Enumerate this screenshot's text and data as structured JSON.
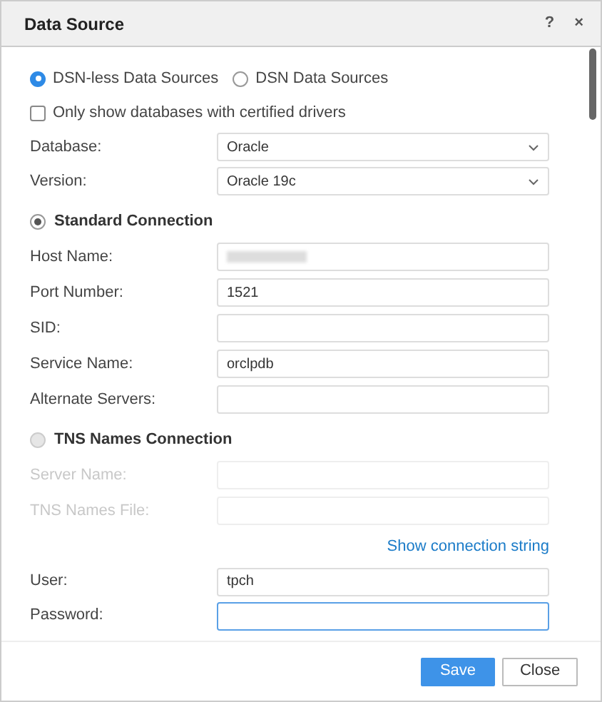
{
  "window": {
    "title": "Data Source",
    "controls": [
      "?",
      "×"
    ]
  },
  "source_types": [
    {
      "label": "DSN-less Data Sources",
      "selected": true
    },
    {
      "label": "DSN Data Sources",
      "selected": false
    }
  ],
  "certified_filter": {
    "label": "Only show databases with certified drivers",
    "checked": false
  },
  "selects": [
    {
      "label": "Database:",
      "value": "Oracle"
    },
    {
      "label": "Version:",
      "value": "Oracle 19c"
    }
  ],
  "connections": [
    {
      "label": "Standard Connection",
      "selected": true,
      "fields": [
        {
          "label": "Host Name:",
          "redacted": true
        },
        {
          "label": "Port Number:",
          "value": "1521"
        },
        {
          "label": "SID:"
        },
        {
          "label": "Service Name:",
          "value": "orclpdb"
        },
        {
          "label": "Alternate Servers:"
        }
      ]
    },
    {
      "label": "TNS Names Connection",
      "selected": false,
      "fields": [
        {
          "label": "Server Name:"
        },
        {
          "label": "TNS Names File:"
        }
      ]
    }
  ],
  "show_connection_string": "Show connection string",
  "credentials": [
    {
      "label": "User:",
      "value": "tpch",
      "focused": false
    },
    {
      "label": "Password:",
      "focused": true
    }
  ],
  "actions": [
    {
      "label": "Save",
      "kind": "primary"
    },
    {
      "label": "Close",
      "kind": "secondary"
    }
  ]
}
